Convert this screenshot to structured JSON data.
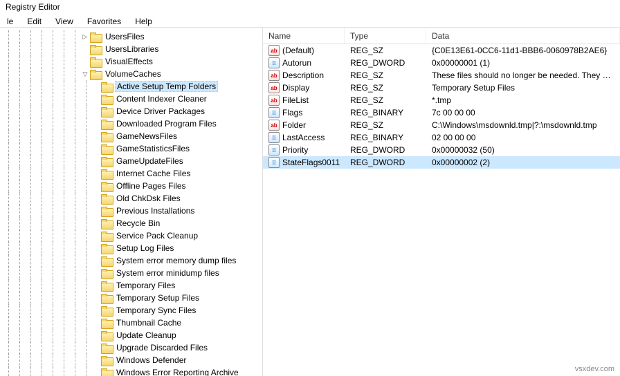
{
  "window_title": "Registry Editor",
  "menu": [
    "le",
    "Edit",
    "View",
    "Favorites",
    "Help"
  ],
  "tree_top": [
    {
      "label": "UsersFiles",
      "exp": "closed",
      "depth": 7
    },
    {
      "label": "UsersLibraries",
      "exp": "none",
      "depth": 7
    },
    {
      "label": "VisualEffects",
      "exp": "none",
      "depth": 7
    },
    {
      "label": "VolumeCaches",
      "exp": "open",
      "depth": 7
    }
  ],
  "tree_children": [
    "Active Setup Temp Folders",
    "Content Indexer Cleaner",
    "Device Driver Packages",
    "Downloaded Program Files",
    "GameNewsFiles",
    "GameStatisticsFiles",
    "GameUpdateFiles",
    "Internet Cache Files",
    "Offline Pages Files",
    "Old ChkDsk Files",
    "Previous Installations",
    "Recycle Bin",
    "Service Pack Cleanup",
    "Setup Log Files",
    "System error memory dump files",
    "System error minidump files",
    "Temporary Files",
    "Temporary Setup Files",
    "Temporary Sync Files",
    "Thumbnail Cache",
    "Update Cleanup",
    "Upgrade Discarded Files",
    "Windows Defender",
    "Windows Error Reporting Archive"
  ],
  "selected_tree": "Active Setup Temp Folders",
  "columns": {
    "name": "Name",
    "type": "Type",
    "data": "Data"
  },
  "values": [
    {
      "name": "(Default)",
      "type": "REG_SZ",
      "data": "{C0E13E61-0CC6-11d1-BBB6-0060978B2AE6}",
      "kind": "str"
    },
    {
      "name": "Autorun",
      "type": "REG_DWORD",
      "data": "0x00000001 (1)",
      "kind": "bin"
    },
    {
      "name": "Description",
      "type": "REG_SZ",
      "data": "These files should no longer be needed. They wer...",
      "kind": "str"
    },
    {
      "name": "Display",
      "type": "REG_SZ",
      "data": "Temporary Setup Files",
      "kind": "str"
    },
    {
      "name": "FileList",
      "type": "REG_SZ",
      "data": "*.tmp",
      "kind": "str"
    },
    {
      "name": "Flags",
      "type": "REG_BINARY",
      "data": "7c 00 00 00",
      "kind": "bin"
    },
    {
      "name": "Folder",
      "type": "REG_SZ",
      "data": "C:\\Windows\\msdownld.tmp|?:\\msdownld.tmp",
      "kind": "str"
    },
    {
      "name": "LastAccess",
      "type": "REG_BINARY",
      "data": "02 00 00 00",
      "kind": "bin"
    },
    {
      "name": "Priority",
      "type": "REG_DWORD",
      "data": "0x00000032 (50)",
      "kind": "bin"
    },
    {
      "name": "StateFlags0011",
      "type": "REG_DWORD",
      "data": "0x00000002 (2)",
      "kind": "bin"
    }
  ],
  "selected_value": "StateFlags0011",
  "watermark": "vsxdev.com",
  "icon_text": {
    "str": "ab",
    "bin": "011\n110"
  }
}
